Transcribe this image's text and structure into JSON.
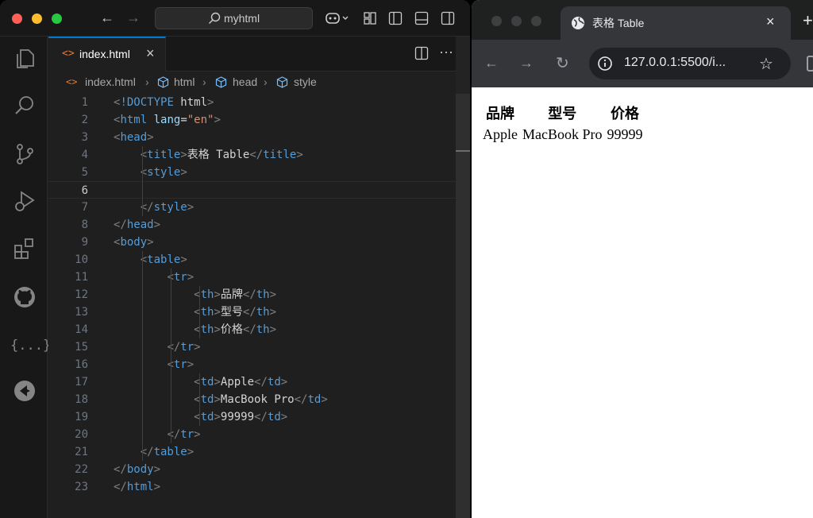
{
  "vscode": {
    "command_center": "myhtml",
    "tab": {
      "label": "index.html",
      "icon": "html-file-icon"
    },
    "breadcrumb": [
      "index.html",
      "html",
      "head",
      "style"
    ],
    "active_line": 6,
    "lines": [
      {
        "n": "1",
        "tokens": [
          [
            "br",
            "<"
          ],
          [
            "tg",
            "!DOCTYPE"
          ],
          [
            "tx",
            " html"
          ],
          [
            "br",
            ">"
          ]
        ]
      },
      {
        "n": "2",
        "tokens": [
          [
            "br",
            "<"
          ],
          [
            "tg",
            "html"
          ],
          [
            "at",
            " lang"
          ],
          [
            "tx",
            "="
          ],
          [
            "st",
            "\"en\""
          ],
          [
            "br",
            ">"
          ]
        ]
      },
      {
        "n": "3",
        "tokens": [
          [
            "br",
            "<"
          ],
          [
            "tg",
            "head"
          ],
          [
            "br",
            ">"
          ]
        ]
      },
      {
        "n": "4",
        "tokens": [
          [
            "tx",
            "    "
          ],
          [
            "br",
            "<"
          ],
          [
            "tg",
            "title"
          ],
          [
            "br",
            ">"
          ],
          [
            "tx",
            "表格 Table"
          ],
          [
            "br",
            "</"
          ],
          [
            "tg",
            "title"
          ],
          [
            "br",
            ">"
          ]
        ]
      },
      {
        "n": "5",
        "tokens": [
          [
            "tx",
            "    "
          ],
          [
            "br",
            "<"
          ],
          [
            "tg",
            "style"
          ],
          [
            "br",
            ">"
          ]
        ]
      },
      {
        "n": "6",
        "tokens": [
          [
            "tx",
            ""
          ]
        ]
      },
      {
        "n": "7",
        "tokens": [
          [
            "tx",
            "    "
          ],
          [
            "br",
            "</"
          ],
          [
            "tg",
            "style"
          ],
          [
            "br",
            ">"
          ]
        ]
      },
      {
        "n": "8",
        "tokens": [
          [
            "br",
            "</"
          ],
          [
            "tg",
            "head"
          ],
          [
            "br",
            ">"
          ]
        ]
      },
      {
        "n": "9",
        "tokens": [
          [
            "br",
            "<"
          ],
          [
            "tg",
            "body"
          ],
          [
            "br",
            ">"
          ]
        ]
      },
      {
        "n": "10",
        "tokens": [
          [
            "tx",
            "    "
          ],
          [
            "br",
            "<"
          ],
          [
            "tg",
            "table"
          ],
          [
            "br",
            ">"
          ]
        ]
      },
      {
        "n": "11",
        "tokens": [
          [
            "tx",
            "        "
          ],
          [
            "br",
            "<"
          ],
          [
            "tg",
            "tr"
          ],
          [
            "br",
            ">"
          ]
        ]
      },
      {
        "n": "12",
        "tokens": [
          [
            "tx",
            "            "
          ],
          [
            "br",
            "<"
          ],
          [
            "tg",
            "th"
          ],
          [
            "br",
            ">"
          ],
          [
            "tx",
            "品牌"
          ],
          [
            "br",
            "</"
          ],
          [
            "tg",
            "th"
          ],
          [
            "br",
            ">"
          ]
        ]
      },
      {
        "n": "13",
        "tokens": [
          [
            "tx",
            "            "
          ],
          [
            "br",
            "<"
          ],
          [
            "tg",
            "th"
          ],
          [
            "br",
            ">"
          ],
          [
            "tx",
            "型号"
          ],
          [
            "br",
            "</"
          ],
          [
            "tg",
            "th"
          ],
          [
            "br",
            ">"
          ]
        ]
      },
      {
        "n": "14",
        "tokens": [
          [
            "tx",
            "            "
          ],
          [
            "br",
            "<"
          ],
          [
            "tg",
            "th"
          ],
          [
            "br",
            ">"
          ],
          [
            "tx",
            "价格"
          ],
          [
            "br",
            "</"
          ],
          [
            "tg",
            "th"
          ],
          [
            "br",
            ">"
          ]
        ]
      },
      {
        "n": "15",
        "tokens": [
          [
            "tx",
            "        "
          ],
          [
            "br",
            "</"
          ],
          [
            "tg",
            "tr"
          ],
          [
            "br",
            ">"
          ]
        ]
      },
      {
        "n": "16",
        "tokens": [
          [
            "tx",
            "        "
          ],
          [
            "br",
            "<"
          ],
          [
            "tg",
            "tr"
          ],
          [
            "br",
            ">"
          ]
        ]
      },
      {
        "n": "17",
        "tokens": [
          [
            "tx",
            "            "
          ],
          [
            "br",
            "<"
          ],
          [
            "tg",
            "td"
          ],
          [
            "br",
            ">"
          ],
          [
            "tx",
            "Apple"
          ],
          [
            "br",
            "</"
          ],
          [
            "tg",
            "td"
          ],
          [
            "br",
            ">"
          ]
        ]
      },
      {
        "n": "18",
        "tokens": [
          [
            "tx",
            "            "
          ],
          [
            "br",
            "<"
          ],
          [
            "tg",
            "td"
          ],
          [
            "br",
            ">"
          ],
          [
            "tx",
            "MacBook Pro"
          ],
          [
            "br",
            "</"
          ],
          [
            "tg",
            "td"
          ],
          [
            "br",
            ">"
          ]
        ]
      },
      {
        "n": "19",
        "tokens": [
          [
            "tx",
            "            "
          ],
          [
            "br",
            "<"
          ],
          [
            "tg",
            "td"
          ],
          [
            "br",
            ">"
          ],
          [
            "tx",
            "99999"
          ],
          [
            "br",
            "</"
          ],
          [
            "tg",
            "td"
          ],
          [
            "br",
            ">"
          ]
        ]
      },
      {
        "n": "20",
        "tokens": [
          [
            "tx",
            "        "
          ],
          [
            "br",
            "</"
          ],
          [
            "tg",
            "tr"
          ],
          [
            "br",
            ">"
          ]
        ]
      },
      {
        "n": "21",
        "tokens": [
          [
            "tx",
            "    "
          ],
          [
            "br",
            "</"
          ],
          [
            "tg",
            "table"
          ],
          [
            "br",
            ">"
          ]
        ]
      },
      {
        "n": "22",
        "tokens": [
          [
            "br",
            "</"
          ],
          [
            "tg",
            "body"
          ],
          [
            "br",
            ">"
          ]
        ]
      },
      {
        "n": "23",
        "tokens": [
          [
            "br",
            "</"
          ],
          [
            "tg",
            "html"
          ],
          [
            "br",
            ">"
          ]
        ]
      }
    ]
  },
  "browser": {
    "tab_title": "表格 Table",
    "url": "127.0.0.1:5500/i...",
    "table": {
      "headers": [
        "品牌",
        "型号",
        "价格"
      ],
      "rows": [
        [
          "Apple",
          "MacBook Pro",
          "99999"
        ]
      ]
    }
  },
  "colors": {
    "tag": "#569cd6",
    "attribute": "#9cdcfe",
    "string": "#ce9178",
    "bracket": "#808080",
    "accent": "#0078d4"
  }
}
